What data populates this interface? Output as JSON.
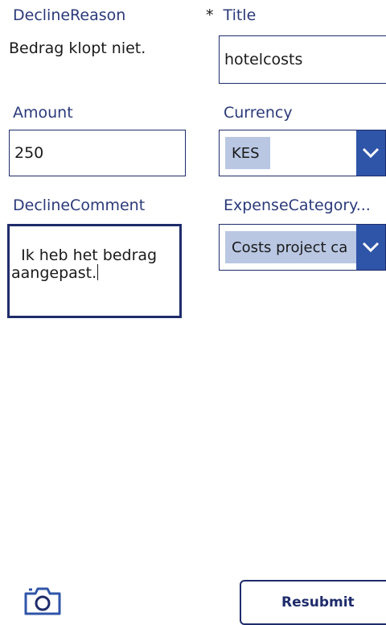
{
  "fields": {
    "decline_reason": {
      "label": "DeclineReason",
      "value": "Bedrag klopt niet."
    },
    "title": {
      "required_mark": "*",
      "label": "Title",
      "value": "hotelcosts"
    },
    "amount": {
      "label": "Amount",
      "value": "250"
    },
    "currency": {
      "label": "Currency",
      "selected": "KES"
    },
    "decline_comment": {
      "label": "DeclineComment",
      "value": "Ik heb het bedrag aangepast."
    },
    "expense_category": {
      "label": "ExpenseCategory...",
      "selected": "Costs project ca"
    }
  },
  "actions": {
    "resubmit_label": "Resubmit",
    "camera_icon": "camera-icon"
  },
  "colors": {
    "label": "#2b3a7a",
    "border": "#1f2c6b",
    "accent": "#2f55a8",
    "selection": "#b9c7e3"
  }
}
